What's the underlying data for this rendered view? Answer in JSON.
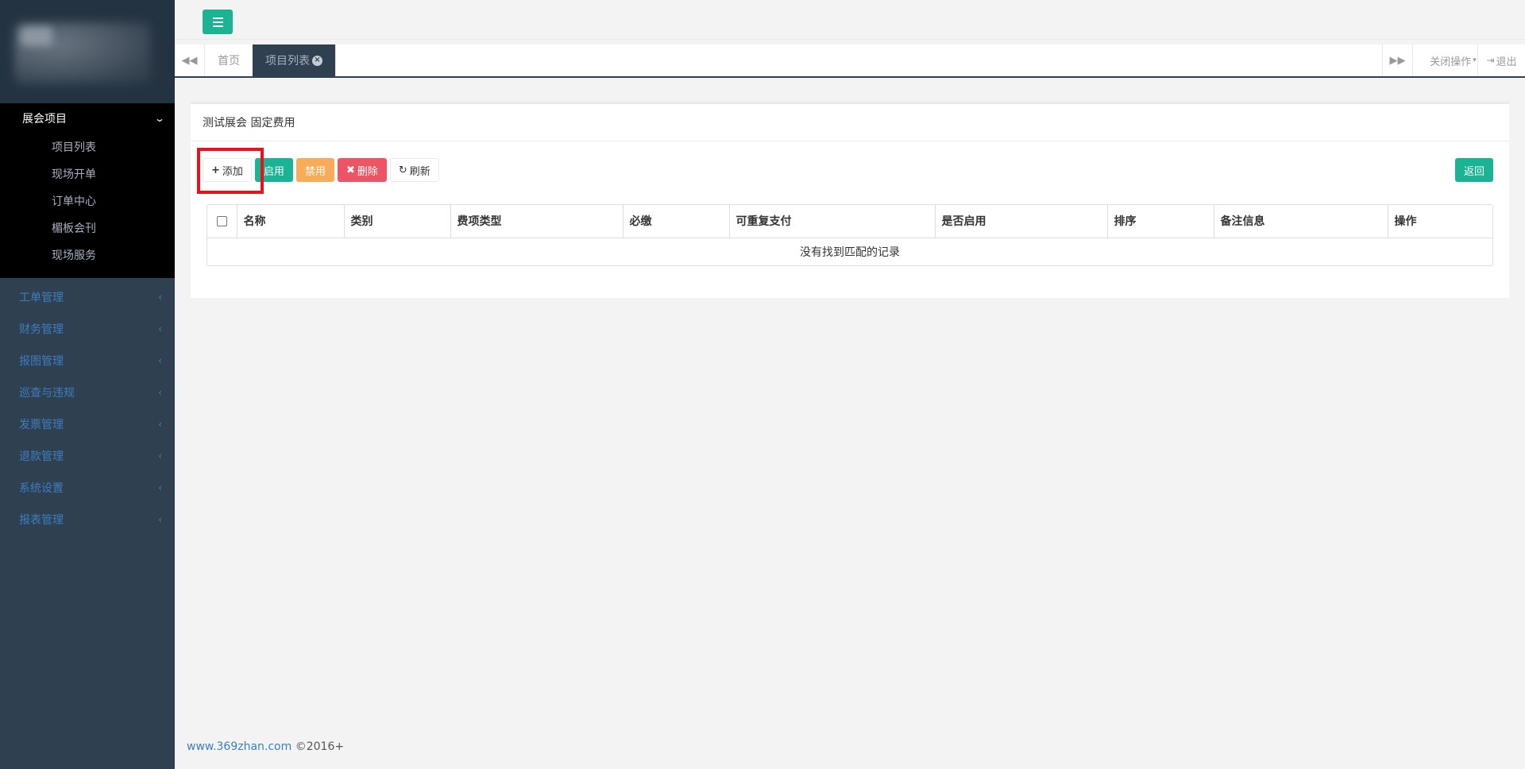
{
  "sidebar": {
    "active_menu": "展会项目",
    "sub_items": [
      "项目列表",
      "现场开单",
      "订单中心",
      "楣板会刊",
      "现场服务"
    ],
    "nav_items": [
      "工单管理",
      "财务管理",
      "报图管理",
      "巡查与违规",
      "发票管理",
      "退款管理",
      "系统设置",
      "报表管理"
    ]
  },
  "tabs": {
    "home": "首页",
    "active": "项目列表",
    "close_ops": "关闭操作",
    "logout": "退出"
  },
  "panel": {
    "title": "测试展会 固定费用"
  },
  "toolbar": {
    "add": "添加",
    "enable": "启用",
    "disable": "禁用",
    "delete": "删除",
    "refresh": "刷新",
    "back": "返回"
  },
  "table": {
    "columns": [
      "名称",
      "类别",
      "费项类型",
      "必缴",
      "可重复支付",
      "是否启用",
      "排序",
      "备注信息",
      "操作"
    ],
    "empty_text": "没有找到匹配的记录"
  },
  "footer": {
    "link": "www.369zhan.com",
    "copyright": "©2016+"
  },
  "colors": {
    "sidebar_bg": "#2f4050",
    "accent_green": "#1ab394",
    "warning_orange": "#f8ac59",
    "danger_red": "#ed5565",
    "highlight_red": "#e8121c"
  }
}
